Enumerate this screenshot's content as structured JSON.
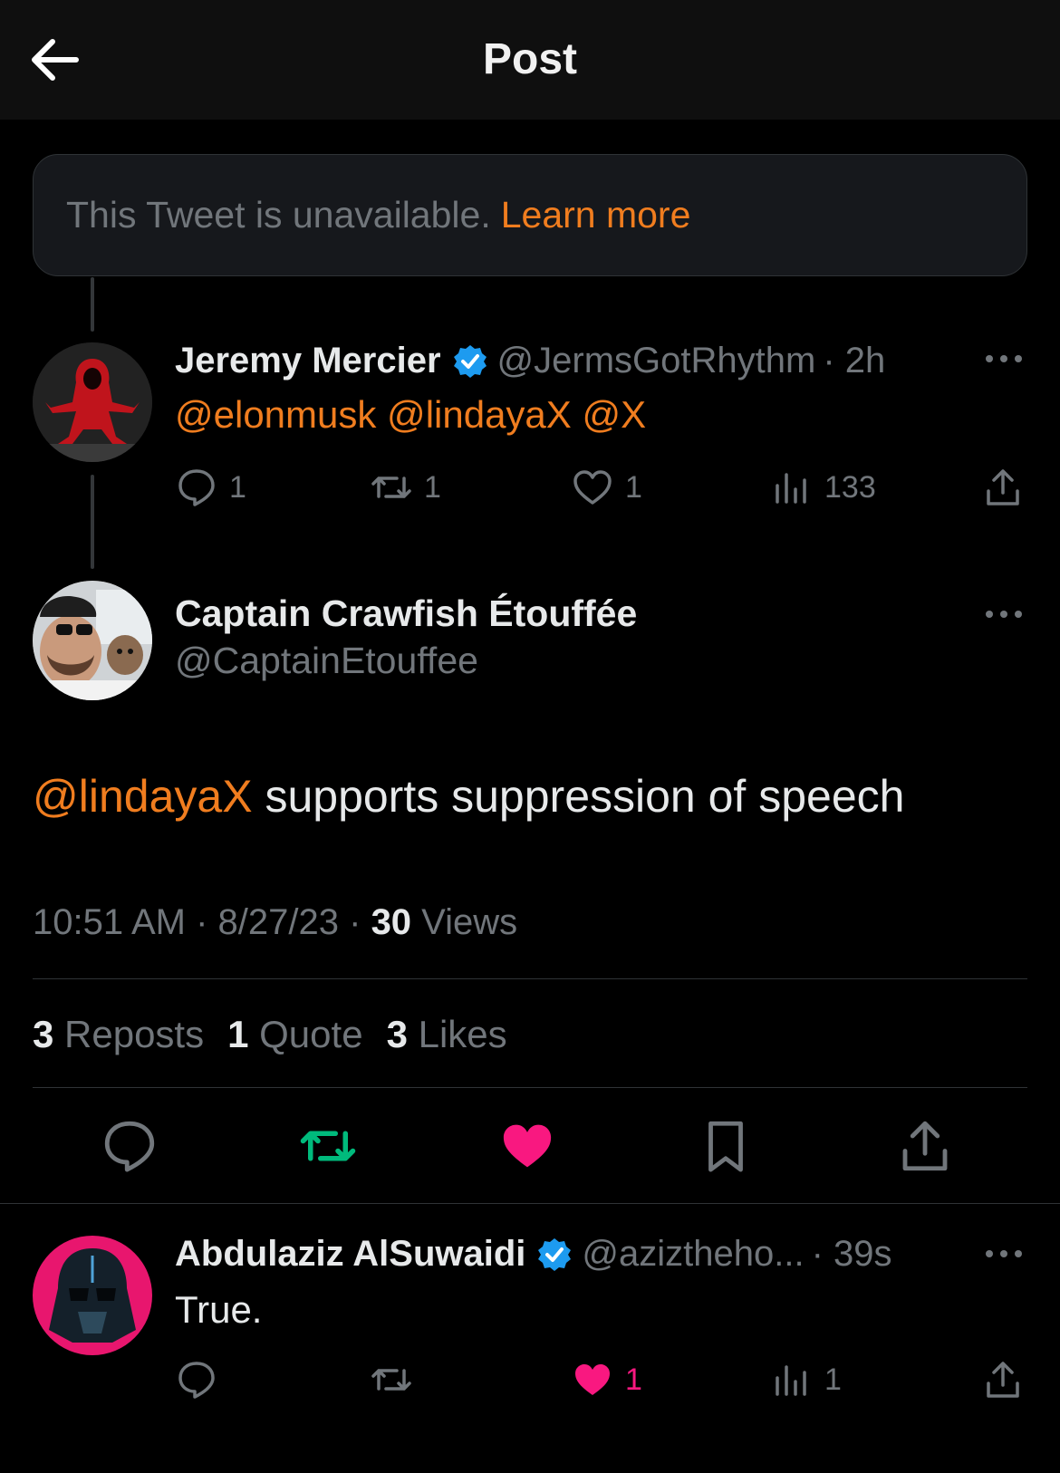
{
  "header": {
    "title": "Post"
  },
  "unavailable": {
    "text": "This Tweet is unavailable.",
    "link": "Learn more"
  },
  "reply1": {
    "name": "Jeremy Mercier",
    "handle": "@JermsGotRhythm",
    "time": "· 2h",
    "mentions": "@elonmusk @lindayaX @X",
    "replies": "1",
    "reposts": "1",
    "likes": "1",
    "views": "133"
  },
  "main": {
    "name": "Captain Crawfish Étouffée",
    "handle": "@CaptainEtouffee",
    "mention": "@lindayaX",
    "text": " supports suppression of speech",
    "time": "10:51 AM · 8/27/23 · ",
    "views_count": "30",
    "views_label": " Views",
    "reposts_count": "3",
    "reposts_label": " Reposts",
    "quote_count": "1",
    "quote_label": " Quote",
    "likes_count": "3",
    "likes_label": " Likes"
  },
  "reply2": {
    "name": "Abdulaziz AlSuwaidi",
    "handle": "@aziztheho...",
    "time": "· 39s",
    "text": "True.",
    "likes": "1",
    "views": "1"
  },
  "colors": {
    "accent": "#f07d1f",
    "verified": "#1d9bf0",
    "repost_active": "#00ba7c",
    "like_active": "#f91880"
  }
}
